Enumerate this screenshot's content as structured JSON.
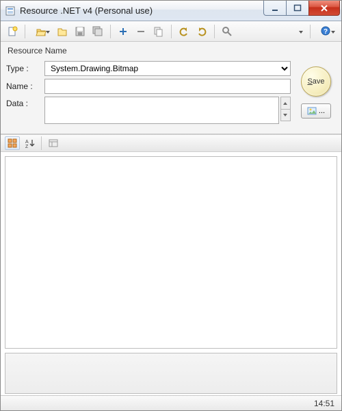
{
  "window": {
    "title": "Resource .NET v4 (Personal use)"
  },
  "form": {
    "group_label": "Resource Name",
    "type_label": "Type :",
    "type_value": "System.Drawing.Bitmap",
    "name_label": "Name :",
    "name_value": "",
    "data_label": "Data :",
    "data_value": "",
    "save_label": "Save",
    "browse_label": "..."
  },
  "status": {
    "time": "14:51"
  },
  "icons": {
    "new": "new-file-icon",
    "open": "open-folder-icon",
    "folder": "folder-icon",
    "save": "save-icon",
    "saveall": "save-all-icon",
    "add": "plus-icon",
    "remove": "minus-icon",
    "copy": "copy-icon",
    "undo": "undo-icon",
    "redo": "redo-icon",
    "find": "find-icon",
    "menu": "dropdown-icon",
    "help": "help-icon",
    "categorized": "categorized-icon",
    "alpha": "alpha-sort-icon",
    "pages": "property-pages-icon",
    "image": "image-icon"
  }
}
